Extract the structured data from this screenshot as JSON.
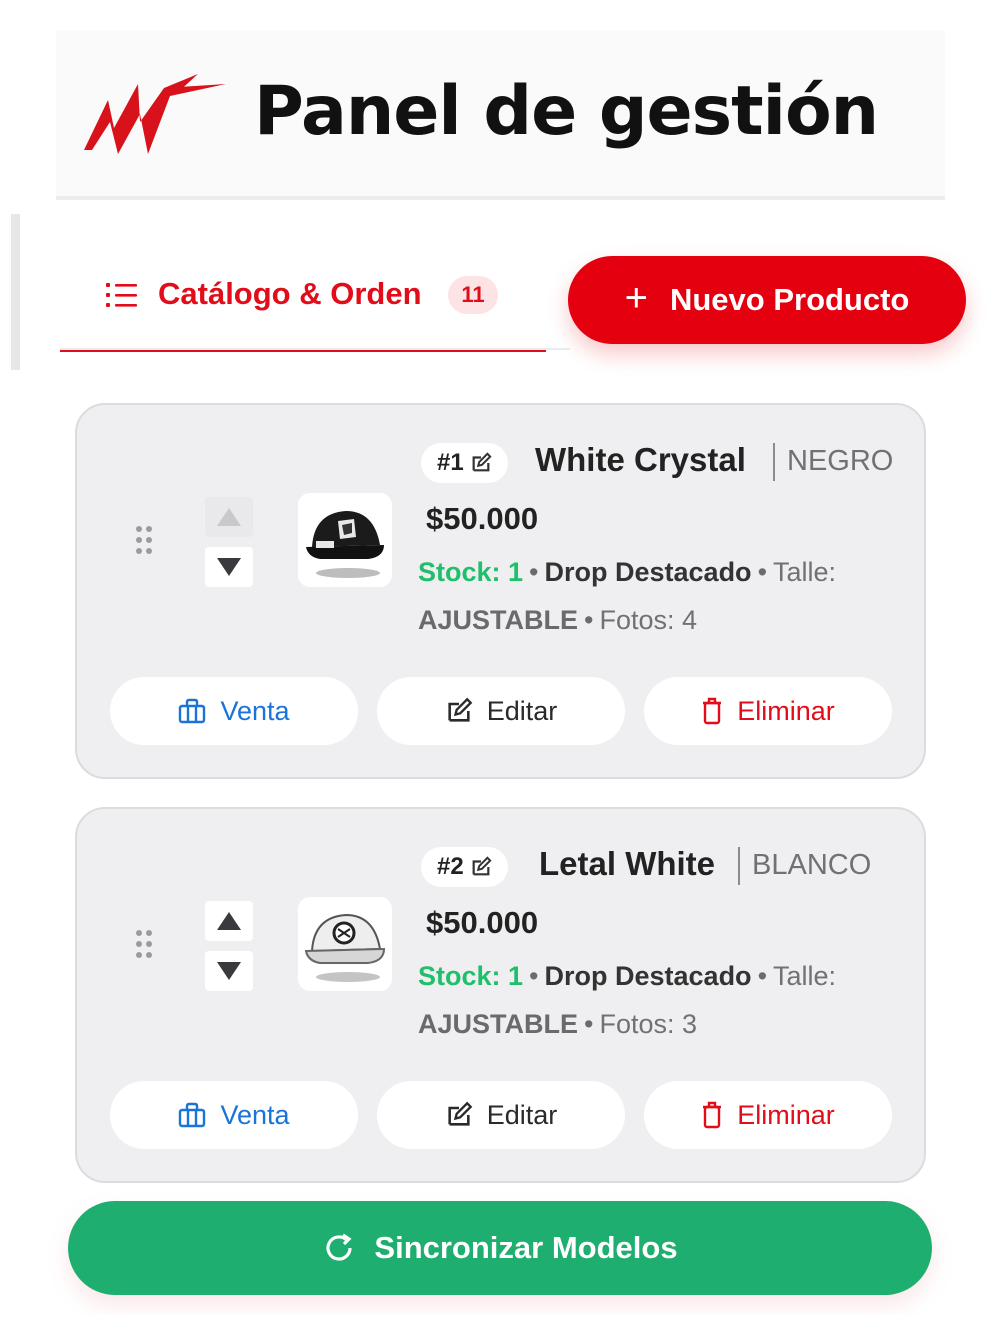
{
  "header": {
    "title": "Panel de gestión",
    "logo_icon": "brand-star-logo-icon"
  },
  "tab": {
    "label": "Catálogo & Orden",
    "count": "11",
    "icon": "list-icon"
  },
  "new_button": {
    "label": "Nuevo Producto",
    "icon": "plus-icon"
  },
  "colors": {
    "accent_red": "#e4000f",
    "sync_green": "#1eae70",
    "stock_green": "#1fbf6b",
    "link_blue": "#1a74d8"
  },
  "products": [
    {
      "number": "#1",
      "name": "White Crystal",
      "color": "NEGRO",
      "price": "$50.000",
      "stock": "Stock: 1",
      "collection": "Drop Destacado",
      "size_label": "Talle:",
      "size_value": "AJUSTABLE",
      "photos": "Fotos: 4",
      "thumbnail": "black-cap-icon",
      "up_disabled": true
    },
    {
      "number": "#2",
      "name": "Letal White",
      "color": "BLANCO",
      "price": "$50.000",
      "stock": "Stock: 1",
      "collection": "Drop Destacado",
      "size_label": "Talle:",
      "size_value": "AJUSTABLE",
      "photos": "Fotos: 3",
      "thumbnail": "white-cap-icon",
      "up_disabled": false
    }
  ],
  "actions": {
    "sale": "Venta",
    "edit": "Editar",
    "delete": "Eliminar"
  },
  "sync_button": {
    "label": "Sincronizar Modelos",
    "icon": "refresh-icon"
  }
}
